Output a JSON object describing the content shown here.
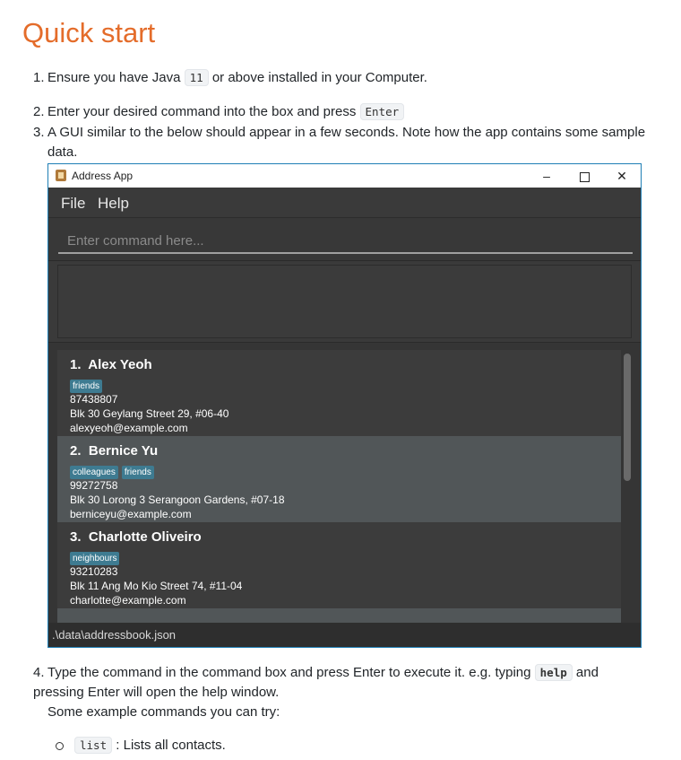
{
  "title": "Quick start",
  "steps": [
    {
      "num": "1.",
      "pre": "Ensure you have Java ",
      "code": "11",
      "post": " or above installed in your Computer."
    },
    {
      "num": "2.",
      "pre": "Enter your desired command into the box and press ",
      "code": "Enter"
    },
    {
      "num": "3.",
      "text": "A GUI similar to the below should appear in a few seconds. Note how the app contains some sample data."
    },
    {
      "num": "4.",
      "pre": "Type the command in the command box and press Enter to execute it. e.g. typing ",
      "code": "help",
      "post": " and pressing Enter will open the help window.",
      "line2": "Some example commands you can try:"
    }
  ],
  "app": {
    "window_title": "Address App",
    "window_controls": {
      "minimize": "–",
      "close": "✕"
    },
    "menu": [
      "File",
      "Help"
    ],
    "command_placeholder": "Enter command here...",
    "persons": [
      {
        "index": "1.",
        "name": "Alex Yeoh",
        "tags": [
          "friends"
        ],
        "phone": "87438807",
        "address": "Blk 30 Geylang Street 29, #06-40",
        "email": "alexyeoh@example.com"
      },
      {
        "index": "2.",
        "name": "Bernice Yu",
        "tags": [
          "colleagues",
          "friends"
        ],
        "phone": "99272758",
        "address": "Blk 30 Lorong 3 Serangoon Gardens, #07-18",
        "email": "berniceyu@example.com"
      },
      {
        "index": "3.",
        "name": "Charlotte Oliveiro",
        "tags": [
          "neighbours"
        ],
        "phone": "93210283",
        "address": "Blk 11 Ang Mo Kio Street 74, #11-04",
        "email": "charlotte@example.com"
      }
    ],
    "status_path": ".\\data\\addressbook.json"
  },
  "examples": [
    {
      "code": "list",
      "desc": " : Lists all contacts."
    }
  ]
}
